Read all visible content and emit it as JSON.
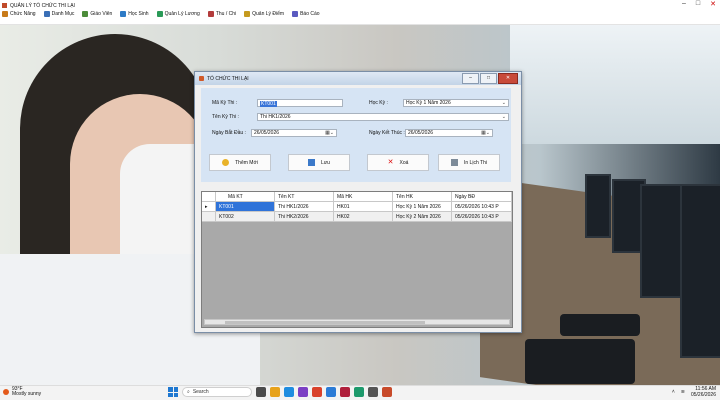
{
  "app": {
    "title": "QUẢN LÝ TỔ CHỨC THI LẠI",
    "menus": [
      {
        "label": "Chức Năng",
        "icon": "gear-icon",
        "color": "#c87b1a"
      },
      {
        "label": "Danh Mục",
        "icon": "list-icon",
        "color": "#3a6fb6"
      },
      {
        "label": "Giáo Viên",
        "icon": "teacher-icon",
        "color": "#4c8c3a"
      },
      {
        "label": "Học Sinh",
        "icon": "student-icon",
        "color": "#2e7bc6"
      },
      {
        "label": "Quản Lý Lương",
        "icon": "money-icon",
        "color": "#2a9a57"
      },
      {
        "label": "Thu / Chi",
        "icon": "receipt-icon",
        "color": "#b33c3c"
      },
      {
        "label": "Quản Lý Điểm",
        "icon": "grades-icon",
        "color": "#c59a1e"
      },
      {
        "label": "Báo Cáo",
        "icon": "report-icon",
        "color": "#5a5ac0"
      }
    ]
  },
  "dialog": {
    "title": "TỔ CHỨC THI LẠI",
    "ma_ky_thi": {
      "label": "Mã Kỳ Thi :",
      "value": "KT001"
    },
    "hoc_ky": {
      "label": "Học Kỳ :",
      "value": "Học Kỳ 1 Năm 2026"
    },
    "ten_ky_thi": {
      "label": "Tên Kỳ Thi :",
      "value": "Thi HK1/2026"
    },
    "ngay_bat_dau": {
      "label": "Ngày Bắt Đầu :",
      "value": "26/05/2026"
    },
    "ngay_ket_thuc": {
      "label": "Ngày Kết Thúc :",
      "value": "26/05/2026"
    },
    "buttons": {
      "add": "Thêm Mới",
      "save": "Lưu",
      "delete": "Xoá",
      "print": "In Lịch Thi"
    },
    "grid": {
      "columns": [
        "Mã KT",
        "Tên KT",
        "Mã HK",
        "Tên HK",
        "Ngày BĐ"
      ],
      "rows": [
        [
          "KT001",
          "Thi HK1/2026",
          "HK01",
          "Học Kỳ 1 Năm 2026",
          "05/26/2026 10:43 P"
        ],
        [
          "KT002",
          "Thi HK2/2026",
          "HK02",
          "Học Kỳ 2 Năm 2026",
          "05/26/2026 10:43 P"
        ]
      ],
      "selected_row": 0
    }
  },
  "taskbar": {
    "weather_temp": "93°F",
    "weather_desc": "Mostly sunny",
    "search_placeholder": "Search",
    "time": "11:56 AM",
    "date": "05/26/2026"
  }
}
